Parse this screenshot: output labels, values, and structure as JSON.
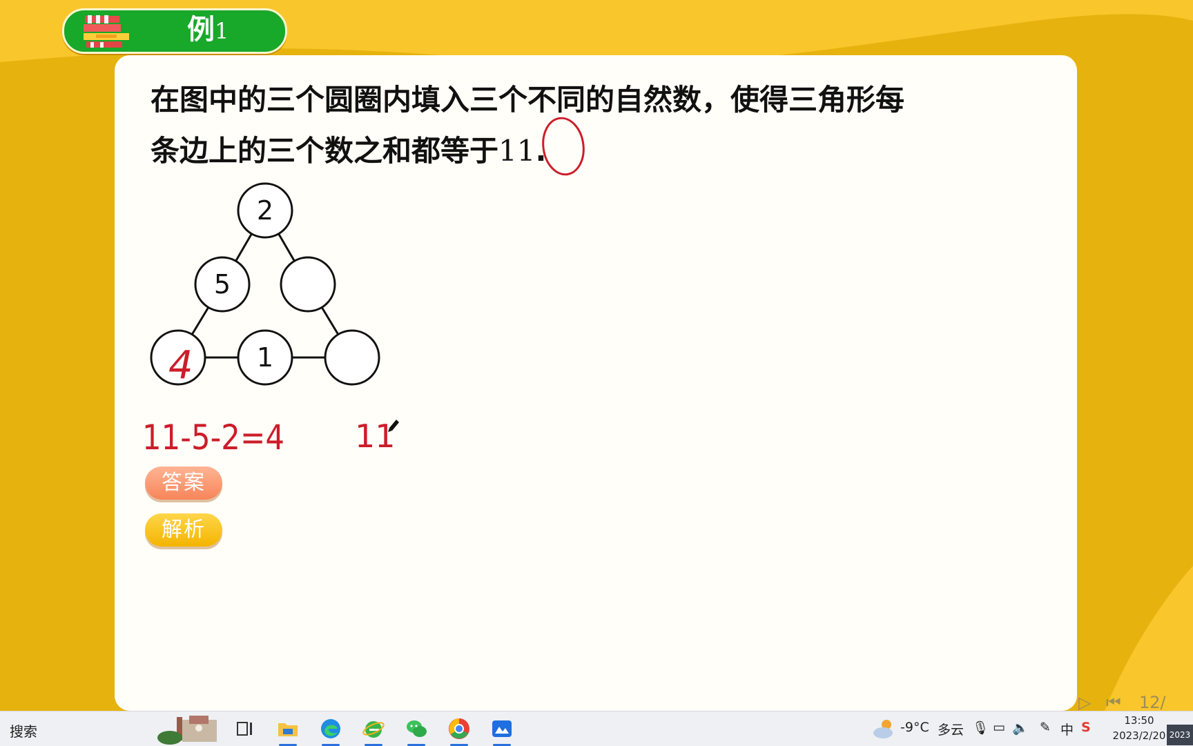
{
  "slide": {
    "title_prefix": "例",
    "title_number": "1",
    "question_line1": "在图中的三个圆圈内填入三个不同的自然数，使得三角形每",
    "question_line2_prefix": "条边上的三个数之和都等于",
    "question_number": "11",
    "question_end": ".",
    "circles": {
      "top": "2",
      "left_mid": "5",
      "right_mid": "",
      "bottom_left": "",
      "bottom_mid": "1",
      "bottom_right": ""
    },
    "handwriting": {
      "circle_value": "4",
      "equation": "11-5-2=4",
      "second_note": "11"
    },
    "buttons": {
      "answer": "答案",
      "analysis": "解析"
    },
    "page_indicator": "12/"
  },
  "taskbar": {
    "search_label": "搜索",
    "weather_temp": "-9°C",
    "weather_desc": "多云",
    "ime_label": "中",
    "time": "13:50",
    "date": "2023/2/20",
    "corner_text": "2023"
  },
  "colors": {
    "background": "#e6b20e",
    "title_pill": "#18a82a",
    "ink": "#cc1d2a",
    "answer_btn": "#f7855a",
    "analysis_btn": "#f4b400"
  }
}
